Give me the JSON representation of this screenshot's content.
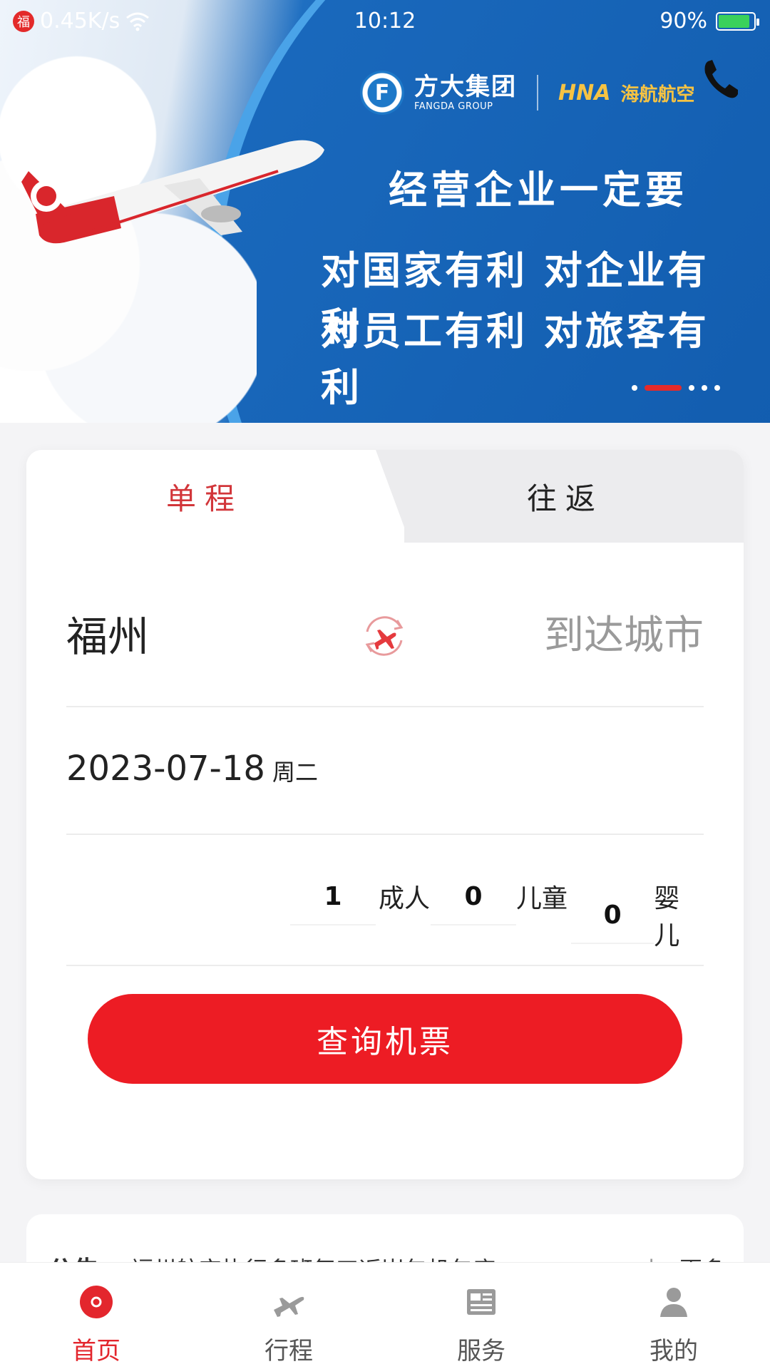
{
  "status_bar": {
    "network_speed": "0.45K/s",
    "time": "10:12",
    "battery": "90%"
  },
  "banner": {
    "brand_fangda_cn": "方大集团",
    "brand_fangda_en": "FANGDA GROUP",
    "brand_hna_en": "HNA",
    "brand_hna_cn": "海航航空",
    "slogan_line1": "经营企业一定要",
    "slogan_line2": "对国家有利 对企业有利",
    "slogan_line3": "对员工有利 对旅客有利",
    "active_slide": 2,
    "slide_count": 5,
    "icons": [
      "phone-icon"
    ]
  },
  "booking": {
    "tabs": {
      "oneway": "单程",
      "return": "往返",
      "active": "oneway"
    },
    "from_city": "福州",
    "to_city_placeholder": "到达城市",
    "date": "2023-07-18",
    "weekday": "周二",
    "passengers": {
      "adult_count": "1",
      "adult_label": "成人",
      "child_count": "0",
      "child_label": "儿童",
      "infant_count": "0",
      "infant_label": "婴儿"
    },
    "search_button": "查询机票",
    "colors": {
      "accent": "#ed1c24",
      "tab_active": "#d2363a"
    }
  },
  "notice": {
    "title": "公告",
    "text": "福州航空执行多班复工返岗包机包座...",
    "separator": "|",
    "more": "更多"
  },
  "bottom_nav": {
    "items": [
      {
        "label": "首页",
        "icon": "home-icon",
        "active": true
      },
      {
        "label": "行程",
        "icon": "plane-icon",
        "active": false
      },
      {
        "label": "服务",
        "icon": "service-icon",
        "active": false
      },
      {
        "label": "我的",
        "icon": "user-icon",
        "active": false
      }
    ]
  }
}
